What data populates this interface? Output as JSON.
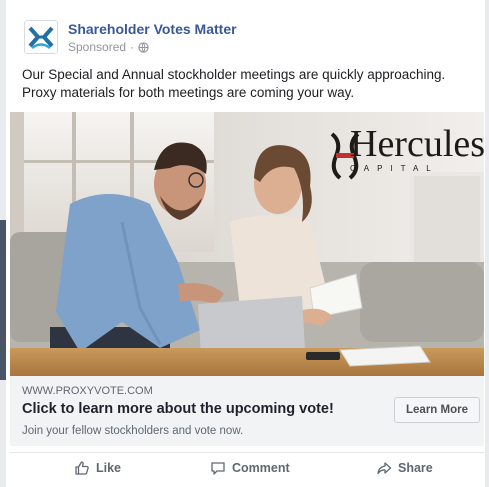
{
  "post": {
    "page_name": "Shareholder Votes Matter",
    "sponsored": "Sponsored",
    "separator": "·",
    "text_line1": "Our Special and Annual stockholder meetings are quickly approaching.",
    "text_line2": "Proxy materials for both meetings are coming your way."
  },
  "image": {
    "brand_name": "Hercules",
    "brand_tag": "CAPITAL"
  },
  "link": {
    "domain": "WWW.PROXYVOTE.COM",
    "title": "Click to learn more about the upcoming vote!",
    "description": "Join your fellow stockholders and vote now.",
    "cta": "Learn More"
  },
  "actions": {
    "like": "Like",
    "comment": "Comment",
    "share": "Share"
  },
  "colors": {
    "page_name": "#385898",
    "link_area_bg": "#f2f3f5",
    "meta_text": "#606770"
  },
  "icons": [
    "page-avatar-logo",
    "globe-icon",
    "like-icon",
    "comment-icon",
    "share-icon"
  ]
}
